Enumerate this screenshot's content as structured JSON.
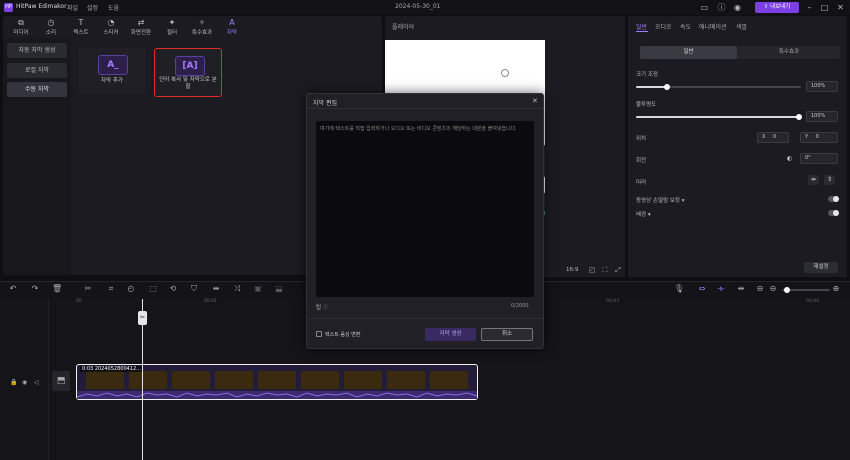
{
  "titlebar": {
    "logo_glyph": "HP",
    "app_name": "HitPaw Edimakor",
    "menus": [
      "파일",
      "설정",
      "도움"
    ],
    "doc_title": "2024-05-30_01",
    "export_label": "⇧ 내보내기"
  },
  "toolbar": {
    "items": [
      {
        "label": "미디어",
        "icon": "media-icon",
        "glyph": "⧉"
      },
      {
        "label": "소리",
        "icon": "audio-icon",
        "glyph": "◷"
      },
      {
        "label": "텍스트",
        "icon": "text-icon",
        "glyph": "T"
      },
      {
        "label": "스티커",
        "icon": "sticker-icon",
        "glyph": "◔"
      },
      {
        "label": "화면전환",
        "icon": "transition-icon",
        "glyph": "⇄"
      },
      {
        "label": "필터",
        "icon": "filter-icon",
        "glyph": "✦"
      },
      {
        "label": "특수효과",
        "icon": "effects-icon",
        "glyph": "✧"
      },
      {
        "label": "자막",
        "icon": "subtitle-icon",
        "glyph": "A"
      }
    ],
    "active": "자막"
  },
  "left_nav": {
    "items": [
      "자동 자막 생성",
      "로컬 자막",
      "수동 자막"
    ],
    "active": "수동 자막"
  },
  "cards": {
    "add_subtitle": {
      "glyph": "A_",
      "label": "자막 추가"
    },
    "split": {
      "glyph": "[A]",
      "label": "단어 복사 및 자막으로 분할"
    }
  },
  "player": {
    "label": "플레이어",
    "aspect": "16:9"
  },
  "right_panel": {
    "tabs": [
      "일반",
      "오디오",
      "속도",
      "애니메이션",
      "색깔"
    ],
    "active_tab": "일반",
    "segments": [
      "일반",
      "특수효과"
    ],
    "size_label": "크기 조정",
    "size_value": "100%",
    "opacity_label": "불투명도",
    "opacity_value": "100%",
    "position_label": "위치",
    "x_label": "X",
    "x_value": "0",
    "y_label": "Y",
    "y_value": "0",
    "rotate_label": "회전",
    "rotate_value": "0°",
    "mirror_label": "미러",
    "stabilize_label": "동영상 손떨림 보정",
    "background_label": "배경",
    "reset_label": "재설정"
  },
  "timeline": {
    "ticks": [
      "00",
      "00:01",
      "00:02",
      "00:03",
      "00:04"
    ],
    "clip_label": "0:03 2024052800412..."
  },
  "dialog": {
    "title": "자막 편집",
    "placeholder": "여기에 텍스트를 직접 입력하거나 오디오 또는 비디오 콘텐츠의 해당하는 대본을 붙여넣습니다.",
    "tip_label": "팁",
    "char_count": "0/2000",
    "voice_label": "텍스트 음성 변환",
    "generate_label": "자막 생성",
    "cancel_label": "취소"
  }
}
